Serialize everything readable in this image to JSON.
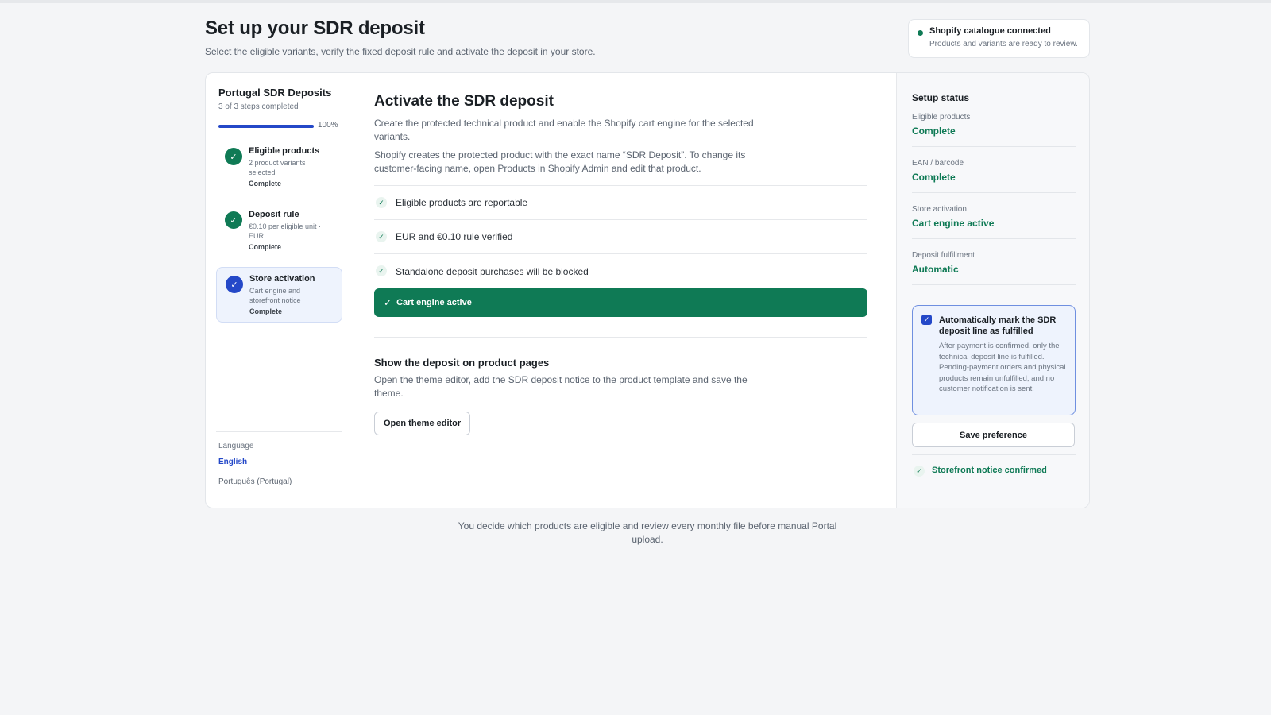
{
  "header": {
    "title": "Set up your SDR deposit",
    "subtitle": "Select the eligible variants, verify the fixed deposit rule and activate the deposit in your store."
  },
  "connection": {
    "title": "Shopify catalogue connected",
    "subtitle": "Products and variants are ready to review."
  },
  "sidebar": {
    "title": "Portugal SDR Deposits",
    "steps_summary": "3 of 3 steps completed",
    "progress": 100,
    "progress_label": "100%",
    "steps": [
      {
        "title": "Eligible products",
        "desc": "2 product variants selected",
        "status": "Complete",
        "icon": "check-icon"
      },
      {
        "title": "Deposit rule",
        "desc": "€0.10 per eligible unit · EUR",
        "status": "Complete",
        "icon": "check-icon"
      },
      {
        "title": "Store activation",
        "desc": "Cart engine and storefront notice",
        "status": "Complete",
        "icon": "check-icon",
        "active": true
      }
    ],
    "language": {
      "label": "Language",
      "current": "English",
      "alternate": "Português (Portugal)"
    }
  },
  "main": {
    "title": "Activate the SDR deposit",
    "desc1": "Create the protected technical product and enable the Shopify cart engine for the selected variants.",
    "desc2": "Shopify creates the protected product with the exact name “SDR Deposit”. To change its customer-facing name, open Products in Shopify Admin and edit that product.",
    "checks": [
      "Eligible products are reportable",
      "EUR and €0.10 rule verified",
      "Standalone deposit purchases will be blocked"
    ],
    "engine_banner": "Cart engine active",
    "theme_section": {
      "title": "Show the deposit on product pages",
      "desc": "Open the theme editor, add the SDR deposit notice to the product template and save the theme.",
      "button": "Open theme editor"
    }
  },
  "status": {
    "title": "Setup status",
    "items": [
      {
        "label": "Eligible products",
        "value": "Complete"
      },
      {
        "label": "EAN / barcode",
        "value": "Complete"
      },
      {
        "label": "Store activation",
        "value": "Cart engine active"
      },
      {
        "label": "Deposit fulfillment",
        "value": "Automatic"
      }
    ],
    "preference": {
      "title": "Automatically mark the SDR deposit line as fulfilled",
      "desc": "After payment is confirmed, only the technical deposit line is fulfilled. Pending-payment orders and physical products remain unfulfilled, and no customer notification is sent.",
      "checked": true
    },
    "save_button": "Save preference",
    "notice": "Storefront notice confirmed"
  },
  "footer": {
    "note": "You decide which products are eligible and review every monthly file before manual Portal upload."
  },
  "colors": {
    "accent_blue": "#2448c8",
    "success_green": "#0f7a55"
  }
}
